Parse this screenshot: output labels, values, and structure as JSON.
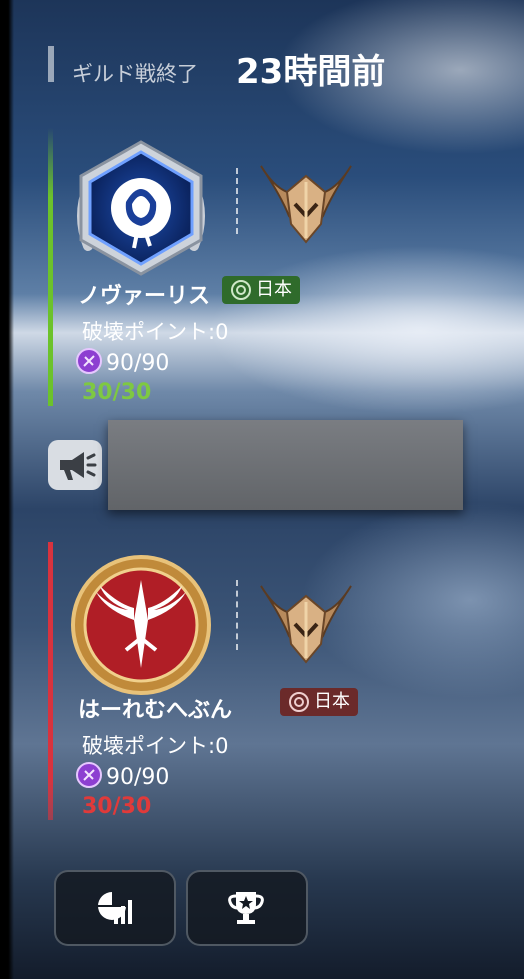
{
  "header": {
    "label": "ギルド戦終了",
    "time": "23時間前"
  },
  "guilds": [
    {
      "name": "ノヴァーリス",
      "region": "日本",
      "destroy_points": "破壊ポイント:0",
      "resource": "90/90",
      "count": "30/30",
      "side_color": "#6cc22b",
      "count_color": "#7ec842",
      "badge_bg": "#2f6b2b",
      "emblem": "rose-emblem",
      "rank": "bronze-rank-helmet-icon"
    },
    {
      "name": "はーれむへぶん",
      "region": "日本",
      "destroy_points": "破壊ポイント:0",
      "resource": "90/90",
      "count": "30/30",
      "side_color": "#d8333e",
      "count_color": "#e03a3a",
      "badge_bg": "#6b2a2a",
      "emblem": "phoenix-emblem",
      "rank": "bronze-rank-helmet-icon"
    }
  ],
  "icons": {
    "announcement": "megaphone-icon",
    "stats_button": "stats-chart-icon",
    "trophy_button": "trophy-icon"
  }
}
